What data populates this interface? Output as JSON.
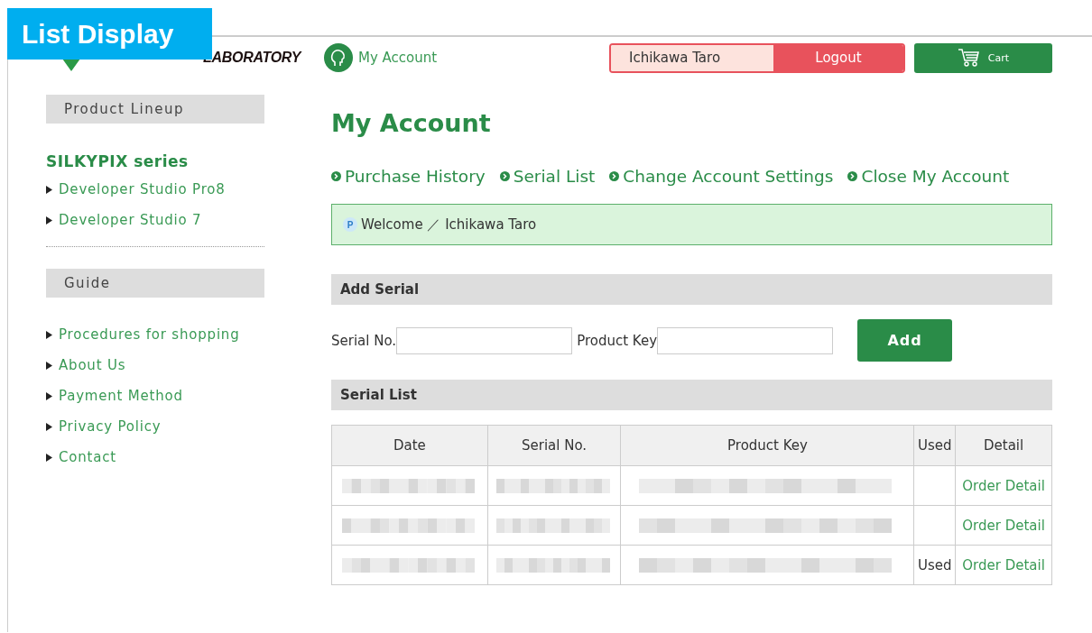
{
  "overlay_label": "List Display",
  "header": {
    "logo_text": "LABORATORY",
    "account_link": "My Account",
    "user_name": "Ichikawa Taro",
    "logout": "Logout",
    "cart": "Cart"
  },
  "sidebar": {
    "sections": [
      {
        "heading": "Product Lineup",
        "title": "SILKYPIX series",
        "items": [
          "Developer Studio Pro8",
          "Developer Studio 7"
        ]
      },
      {
        "heading": "Guide",
        "items": [
          "Procedures for shopping",
          "About Us",
          "Payment Method",
          "Privacy Policy",
          "Contact"
        ]
      }
    ]
  },
  "main": {
    "title": "My Account",
    "nav_links": [
      "Purchase History",
      "Serial List",
      "Change Account Settings",
      "Close My Account"
    ],
    "welcome": {
      "badge": "P",
      "text": "Welcome ／ Ichikawa Taro"
    },
    "add_serial": {
      "heading": "Add Serial",
      "serial_label": "Serial No.",
      "key_label": "Product Key",
      "button": "Add"
    },
    "serial_list": {
      "heading": "Serial List",
      "columns": [
        "Date",
        "Serial No.",
        "Product Key",
        "Used",
        "Detail"
      ],
      "rows": [
        {
          "kind": "redacted",
          "detail": "Order Detail"
        },
        {
          "kind": "redacted",
          "detail": "Order Detail"
        },
        {
          "kind": "redacted",
          "used": "Used",
          "detail": "Order Detail"
        }
      ]
    }
  }
}
